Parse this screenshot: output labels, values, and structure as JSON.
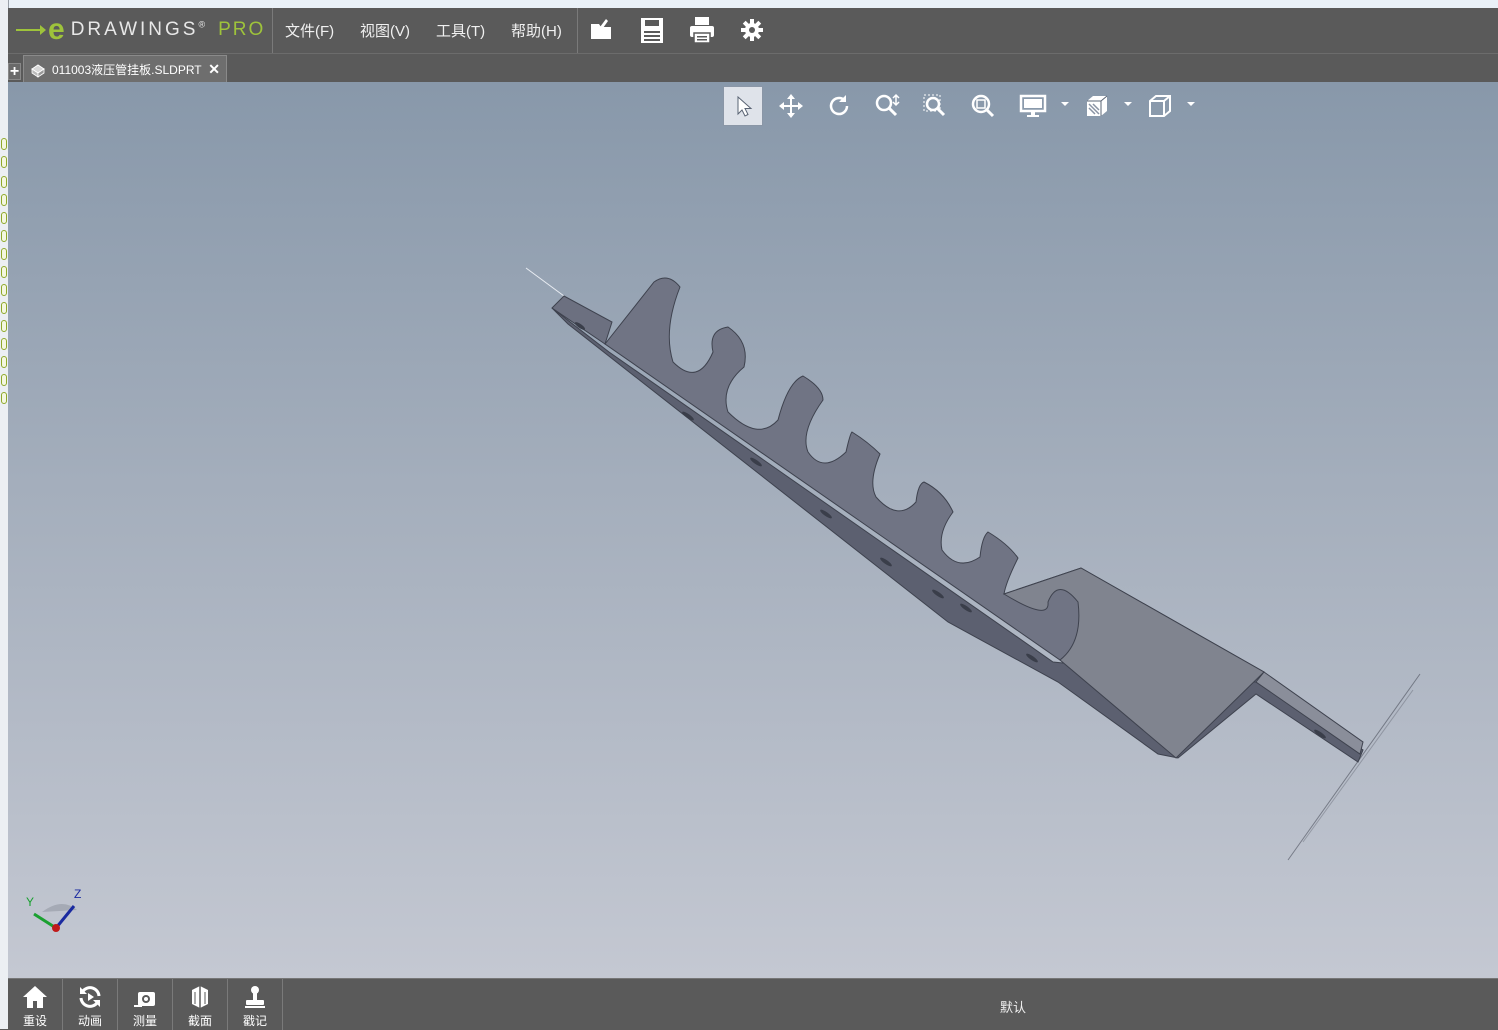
{
  "app": {
    "logo_mark": "e",
    "logo_name": "DRAWINGS",
    "logo_reg": "®",
    "logo_edition": "PRO"
  },
  "menu": {
    "file": "文件(F)",
    "view": "视图(V)",
    "tools": "工具(T)",
    "help": "帮助(H)"
  },
  "toolbar_icons": [
    "open-icon",
    "save-icon",
    "print-icon",
    "settings-icon"
  ],
  "tab": {
    "add": "+",
    "title": "011003液压管挂板.SLDPRT",
    "close": "✕"
  },
  "view_toolbar": [
    "select-icon",
    "pan-icon",
    "rotate-icon",
    "zoom-icon",
    "zoom-area-icon",
    "zoom-fit-icon",
    "display-icon",
    "shading-icon",
    "view-orientation-icon"
  ],
  "triad": {
    "y": "Y",
    "z": "Z"
  },
  "bottom_buttons": [
    {
      "label": "重设",
      "icon": "home-icon"
    },
    {
      "label": "动画",
      "icon": "animate-icon"
    },
    {
      "label": "测量",
      "icon": "measure-icon"
    },
    {
      "label": "截面",
      "icon": "section-icon"
    },
    {
      "label": "戳记",
      "icon": "stamp-icon"
    }
  ],
  "configuration": "默认",
  "colors": {
    "accent": "#9ec33b",
    "chrome": "#5a5a5a",
    "part": "#6b6f7f"
  }
}
